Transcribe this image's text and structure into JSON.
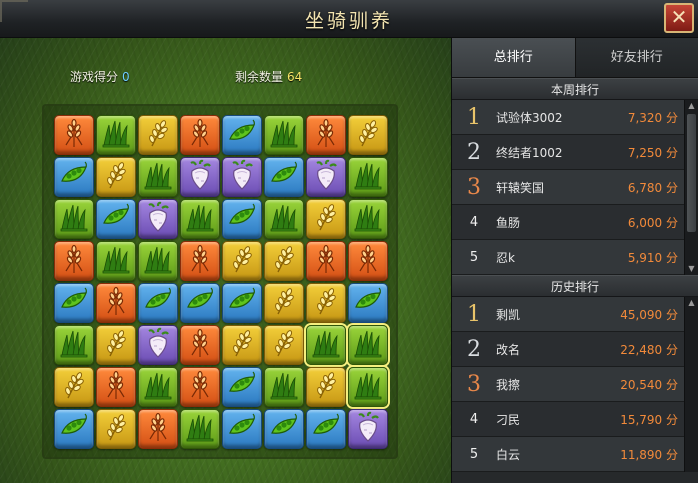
{
  "window": {
    "title": "坐骑驯养",
    "close_label": "✕"
  },
  "game": {
    "score_label": "游戏得分",
    "score_value": "0",
    "remaining_label": "剩余数量",
    "remaining_value": "64",
    "colors": {
      "wheat": "#e0631f",
      "grass": "#79b827",
      "grain": "#e0b422",
      "pea": "#3f95d8",
      "radish": "#8466c9"
    },
    "board": [
      [
        "wheat",
        "grass",
        "grain",
        "wheat",
        "pea",
        "grass",
        "wheat",
        "grain"
      ],
      [
        "pea",
        "grain",
        "grass",
        "radish",
        "radish",
        "pea",
        "radish",
        "grass"
      ],
      [
        "grass",
        "pea",
        "radish",
        "grass",
        "pea",
        "grass",
        "grain",
        "grass"
      ],
      [
        "wheat",
        "grass",
        "grass",
        "wheat",
        "grain",
        "grain",
        "wheat",
        "wheat"
      ],
      [
        "pea",
        "wheat",
        "pea",
        "pea",
        "pea",
        "grain",
        "grain",
        "pea"
      ],
      [
        "grass",
        "grain",
        "radish",
        "wheat",
        "grain",
        "grain",
        "grass",
        "grass"
      ],
      [
        "grain",
        "wheat",
        "grass",
        "wheat",
        "pea",
        "grass",
        "grain",
        "grass"
      ],
      [
        "pea",
        "grain",
        "wheat",
        "grass",
        "pea",
        "pea",
        "pea",
        "radish"
      ]
    ],
    "highlighted": [
      [
        5,
        6
      ],
      [
        5,
        7
      ],
      [
        6,
        7
      ]
    ]
  },
  "tabs": [
    {
      "label": "总排行",
      "active": true
    },
    {
      "label": "好友排行",
      "active": false
    }
  ],
  "weekly": {
    "heading": "本周排行",
    "rows": [
      {
        "rank": "1",
        "name": "试验体3002",
        "score": "7,320 分"
      },
      {
        "rank": "2",
        "name": "终结者1002",
        "score": "7,250 分"
      },
      {
        "rank": "3",
        "name": "轩辕笑国",
        "score": "6,780 分"
      },
      {
        "rank": "4",
        "name": "鱼肠",
        "score": "6,000 分"
      },
      {
        "rank": "5",
        "name": "忍k",
        "score": "5,910 分"
      }
    ]
  },
  "history": {
    "heading": "历史排行",
    "rows": [
      {
        "rank": "1",
        "name": "剩凯",
        "score": "45,090 分"
      },
      {
        "rank": "2",
        "name": "改名",
        "score": "22,480 分"
      },
      {
        "rank": "3",
        "name": "我擦",
        "score": "20,540 分"
      },
      {
        "rank": "4",
        "name": "刁民",
        "score": "15,790 分"
      },
      {
        "rank": "5",
        "name": "白云",
        "score": "11,890 分"
      }
    ]
  },
  "scroll_arrows": {
    "up": "▲",
    "down": "▼"
  }
}
